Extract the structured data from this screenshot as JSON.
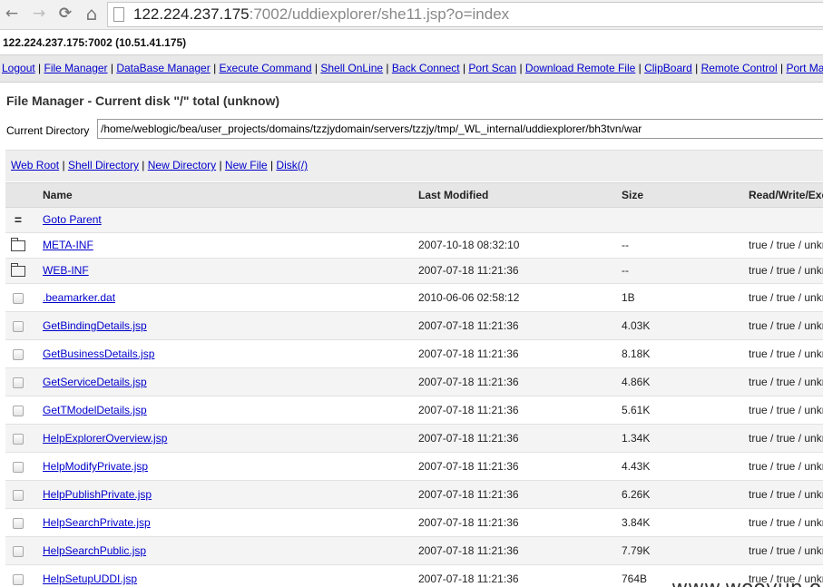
{
  "browser": {
    "back_icon": "←",
    "forward_icon": "→",
    "reload_icon": "⟳",
    "home_icon": "⌂",
    "url_host": "122.224.237.175",
    "url_rest": ":7002/uddiexplorer/she11.jsp?o=index"
  },
  "host_line": "122.224.237.175:7002 (10.51.41.175)",
  "menu": [
    "Logout",
    "File Manager",
    "DataBase Manager",
    "Execute Command",
    "Shell OnLine",
    "Back Connect",
    "Port Scan",
    "Download Remote File",
    "ClipBoard",
    "Remote Control",
    "Port Map"
  ],
  "file_manager": {
    "title": "File Manager - Current disk \"/\" total (unknow)",
    "current_dir_label": "Current Directory",
    "current_dir_value": "/home/weblogic/bea/user_projects/domains/tzzjydomain/servers/tzzjy/tmp/_WL_internal/uddiexplorer/bh3tvn/war",
    "shortcuts": [
      "Web Root",
      "Shell Directory",
      "New Directory",
      "New File",
      "Disk(/)"
    ]
  },
  "table": {
    "headers": {
      "name": "Name",
      "last_modified": "Last Modified",
      "size": "Size",
      "rwx": "Read/Write/Execute"
    },
    "parent": {
      "icon": "equals-icon",
      "label": "Goto Parent"
    },
    "rows": [
      {
        "type": "dir",
        "name": "META-INF",
        "modified": "2007-10-18 08:32:10",
        "size": "--",
        "rwx": "true / true / unknow"
      },
      {
        "type": "dir",
        "name": "WEB-INF",
        "modified": "2007-07-18 11:21:36",
        "size": "--",
        "rwx": "true / true / unknow"
      },
      {
        "type": "file",
        "name": ".beamarker.dat",
        "modified": "2010-06-06 02:58:12",
        "size": "1B",
        "rwx": "true / true / unknow"
      },
      {
        "type": "file",
        "name": "GetBindingDetails.jsp",
        "modified": "2007-07-18 11:21:36",
        "size": "4.03K",
        "rwx": "true / true / unknow"
      },
      {
        "type": "file",
        "name": "GetBusinessDetails.jsp",
        "modified": "2007-07-18 11:21:36",
        "size": "8.18K",
        "rwx": "true / true / unknow"
      },
      {
        "type": "file",
        "name": "GetServiceDetails.jsp",
        "modified": "2007-07-18 11:21:36",
        "size": "4.86K",
        "rwx": "true / true / unknow"
      },
      {
        "type": "file",
        "name": "GetTModelDetails.jsp",
        "modified": "2007-07-18 11:21:36",
        "size": "5.61K",
        "rwx": "true / true / unknow"
      },
      {
        "type": "file",
        "name": "HelpExplorerOverview.jsp",
        "modified": "2007-07-18 11:21:36",
        "size": "1.34K",
        "rwx": "true / true / unknow"
      },
      {
        "type": "file",
        "name": "HelpModifyPrivate.jsp",
        "modified": "2007-07-18 11:21:36",
        "size": "4.43K",
        "rwx": "true / true / unknow"
      },
      {
        "type": "file",
        "name": "HelpPublishPrivate.jsp",
        "modified": "2007-07-18 11:21:36",
        "size": "6.26K",
        "rwx": "true / true / unknow"
      },
      {
        "type": "file",
        "name": "HelpSearchPrivate.jsp",
        "modified": "2007-07-18 11:21:36",
        "size": "3.84K",
        "rwx": "true / true / unknow"
      },
      {
        "type": "file",
        "name": "HelpSearchPublic.jsp",
        "modified": "2007-07-18 11:21:36",
        "size": "7.79K",
        "rwx": "true / true / unknow"
      },
      {
        "type": "file",
        "name": "HelpSetupUDDI.jsp",
        "modified": "2007-07-18 11:21:36",
        "size": "764B",
        "rwx": "true / true / unknow"
      }
    ]
  },
  "watermark": "www.wooyun.org"
}
